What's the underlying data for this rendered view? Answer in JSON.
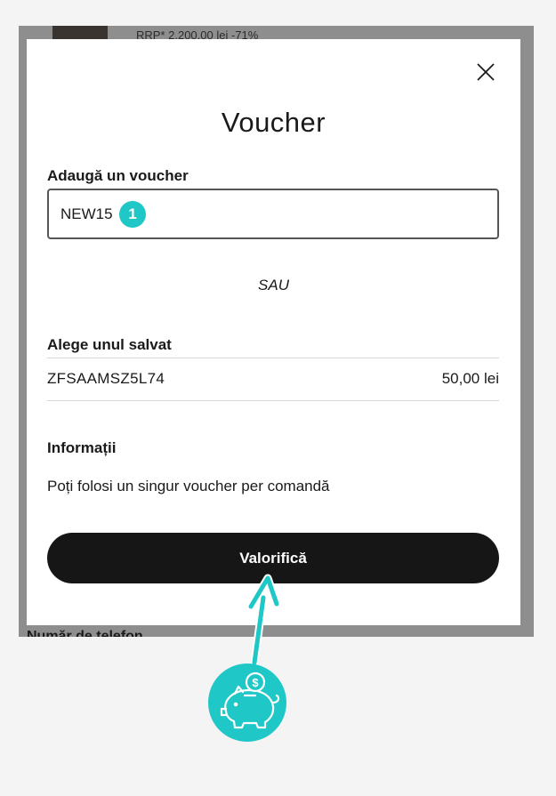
{
  "background": {
    "rrp_text": "RRP* 2.200,00 lei  -71%",
    "phone_label": "Număr de telefon"
  },
  "modal": {
    "title": "Voucher",
    "add_label": "Adaugă un voucher",
    "voucher_value": "NEW15",
    "step_number": "1",
    "or_text": "SAU",
    "saved_label": "Alege unul salvat",
    "saved_vouchers": [
      {
        "code": "ZFSAAMSZ5L74",
        "amount": "50,00 lei"
      }
    ],
    "info_label": "Informații",
    "info_text": "Poți folosi un singur voucher per comandă",
    "apply_label": "Valorifică"
  },
  "annotation": {
    "accent_color": "#20c7c7",
    "coin_symbol": "$"
  },
  "icons": {
    "close": "close-icon",
    "piggy_bank": "piggy-bank-icon",
    "coin": "coin-icon",
    "arrow": "arrow-up-icon"
  }
}
